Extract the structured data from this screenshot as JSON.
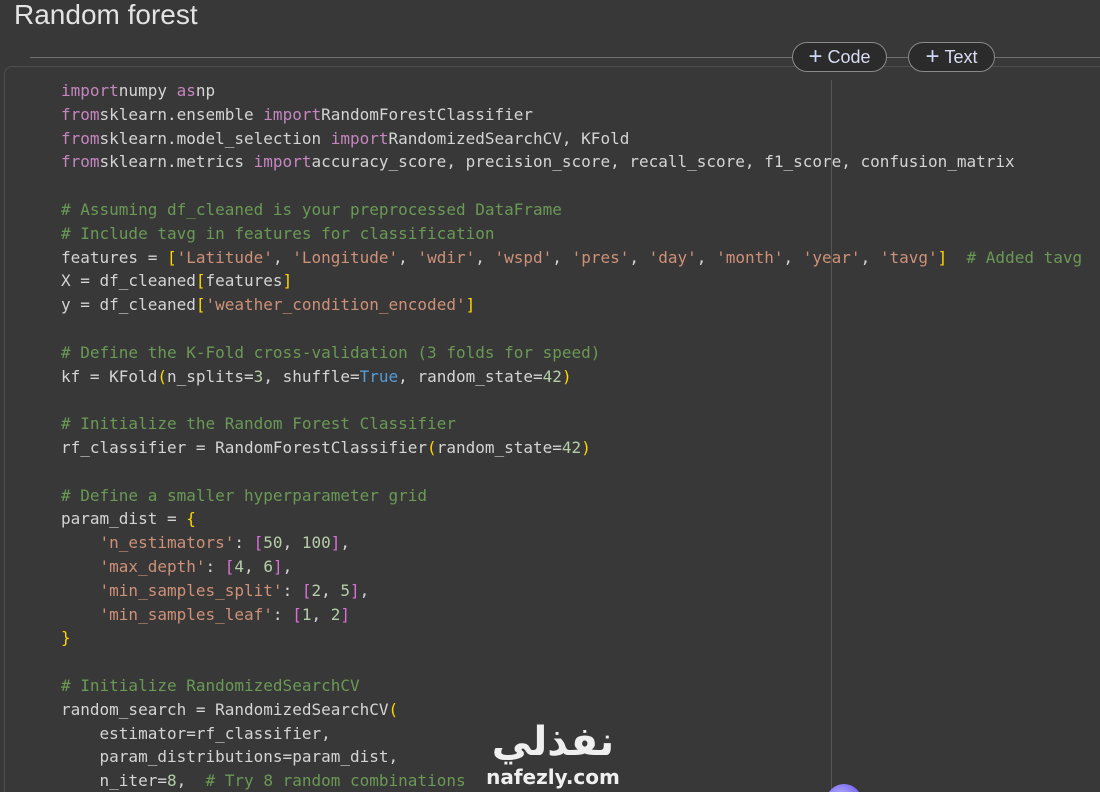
{
  "section": {
    "title": "Random forest"
  },
  "toolbar": {
    "add_code_label": "Code",
    "add_text_label": "Text",
    "plus_glyph": "+"
  },
  "code_lines": [
    [
      [
        "kw",
        "import"
      ],
      [
        "",
        "numpy "
      ],
      [
        "kw",
        "as"
      ],
      [
        "",
        "np"
      ]
    ],
    [
      [
        "kw",
        "from"
      ],
      [
        "",
        "sklearn.ensemble "
      ],
      [
        "kw",
        "import"
      ],
      [
        "",
        "RandomForestClassifier"
      ]
    ],
    [
      [
        "kw",
        "from"
      ],
      [
        "",
        "sklearn.model_selection "
      ],
      [
        "kw",
        "import"
      ],
      [
        "",
        "RandomizedSearchCV, KFold"
      ]
    ],
    [
      [
        "kw",
        "from"
      ],
      [
        "",
        "sklearn.metrics "
      ],
      [
        "kw",
        "import"
      ],
      [
        "",
        "accuracy_score, precision_score, recall_score, f1_score, confusion_matrix"
      ]
    ],
    [],
    [
      [
        "cm",
        "# Assuming df_cleaned is your preprocessed DataFrame"
      ]
    ],
    [
      [
        "cm",
        "# Include tavg in features for classification"
      ]
    ],
    [
      [
        "",
        "features = "
      ],
      [
        "b1",
        "["
      ],
      [
        "st",
        "'Latitude'"
      ],
      [
        "",
        ", "
      ],
      [
        "st",
        "'Longitude'"
      ],
      [
        "",
        ", "
      ],
      [
        "st",
        "'wdir'"
      ],
      [
        "",
        ", "
      ],
      [
        "st",
        "'wspd'"
      ],
      [
        "",
        ", "
      ],
      [
        "st",
        "'pres'"
      ],
      [
        "",
        ", "
      ],
      [
        "st",
        "'day'"
      ],
      [
        "",
        ", "
      ],
      [
        "st",
        "'month'"
      ],
      [
        "",
        ", "
      ],
      [
        "st",
        "'year'"
      ],
      [
        "",
        ", "
      ],
      [
        "st",
        "'tavg'"
      ],
      [
        "b1",
        "]"
      ],
      [
        "",
        "  "
      ],
      [
        "cm",
        "# Added tavg"
      ]
    ],
    [
      [
        "",
        "X = df_cleaned"
      ],
      [
        "b1",
        "["
      ],
      [
        "",
        "features"
      ],
      [
        "b1",
        "]"
      ]
    ],
    [
      [
        "",
        "y = df_cleaned"
      ],
      [
        "b1",
        "["
      ],
      [
        "st",
        "'weather_condition_encoded'"
      ],
      [
        "b1",
        "]"
      ]
    ],
    [],
    [
      [
        "cm",
        "# Define the K-Fold cross-validation (3 folds for speed)"
      ]
    ],
    [
      [
        "",
        "kf = KFold"
      ],
      [
        "b1",
        "("
      ],
      [
        "",
        "n_splits="
      ],
      [
        "nu",
        "3"
      ],
      [
        "",
        ", shuffle="
      ],
      [
        "bu",
        "True"
      ],
      [
        "",
        ", random_state="
      ],
      [
        "nu",
        "42"
      ],
      [
        "b1",
        ")"
      ]
    ],
    [],
    [
      [
        "cm",
        "# Initialize the Random Forest Classifier"
      ]
    ],
    [
      [
        "",
        "rf_classifier = RandomForestClassifier"
      ],
      [
        "b1",
        "("
      ],
      [
        "",
        "random_state="
      ],
      [
        "nu",
        "42"
      ],
      [
        "b1",
        ")"
      ]
    ],
    [],
    [
      [
        "cm",
        "# Define a smaller hyperparameter grid"
      ]
    ],
    [
      [
        "",
        "param_dist = "
      ],
      [
        "b1",
        "{"
      ]
    ],
    [
      [
        "",
        "    "
      ],
      [
        "st",
        "'n_estimators'"
      ],
      [
        "",
        ": "
      ],
      [
        "b2",
        "["
      ],
      [
        "nu",
        "50"
      ],
      [
        "",
        ", "
      ],
      [
        "nu",
        "100"
      ],
      [
        "b2",
        "]"
      ],
      [
        "",
        ","
      ]
    ],
    [
      [
        "",
        "    "
      ],
      [
        "st",
        "'max_depth'"
      ],
      [
        "",
        ": "
      ],
      [
        "b2",
        "["
      ],
      [
        "nu",
        "4"
      ],
      [
        "",
        ", "
      ],
      [
        "nu",
        "6"
      ],
      [
        "b2",
        "]"
      ],
      [
        "",
        ","
      ]
    ],
    [
      [
        "",
        "    "
      ],
      [
        "st",
        "'min_samples_split'"
      ],
      [
        "",
        ": "
      ],
      [
        "b2",
        "["
      ],
      [
        "nu",
        "2"
      ],
      [
        "",
        ", "
      ],
      [
        "nu",
        "5"
      ],
      [
        "b2",
        "]"
      ],
      [
        "",
        ","
      ]
    ],
    [
      [
        "",
        "    "
      ],
      [
        "st",
        "'min_samples_leaf'"
      ],
      [
        "",
        ": "
      ],
      [
        "b2",
        "["
      ],
      [
        "nu",
        "1"
      ],
      [
        "",
        ", "
      ],
      [
        "nu",
        "2"
      ],
      [
        "b2",
        "]"
      ]
    ],
    [
      [
        "b1",
        "}"
      ]
    ],
    [],
    [
      [
        "cm",
        "# Initialize RandomizedSearchCV"
      ]
    ],
    [
      [
        "",
        "random_search = RandomizedSearchCV"
      ],
      [
        "b1",
        "("
      ]
    ],
    [
      [
        "",
        "    estimator=rf_classifier,"
      ]
    ],
    [
      [
        "",
        "    param_distributions=param_dist,"
      ]
    ],
    [
      [
        "",
        "    n_iter="
      ],
      [
        "nu",
        "8"
      ],
      [
        "",
        ",  "
      ],
      [
        "cm",
        "# Try 8 random combinations"
      ]
    ]
  ],
  "watermark": {
    "arabic": "نفذلي",
    "latin": "nafezly.com"
  },
  "colors": {
    "background": "#383838",
    "keyword": "#c586c0",
    "comment": "#6a9955",
    "string": "#ce9178",
    "number": "#b5cea8",
    "builtin": "#569cd6",
    "bracket_level1": "#ffd700",
    "bracket_level2": "#da70d6"
  }
}
